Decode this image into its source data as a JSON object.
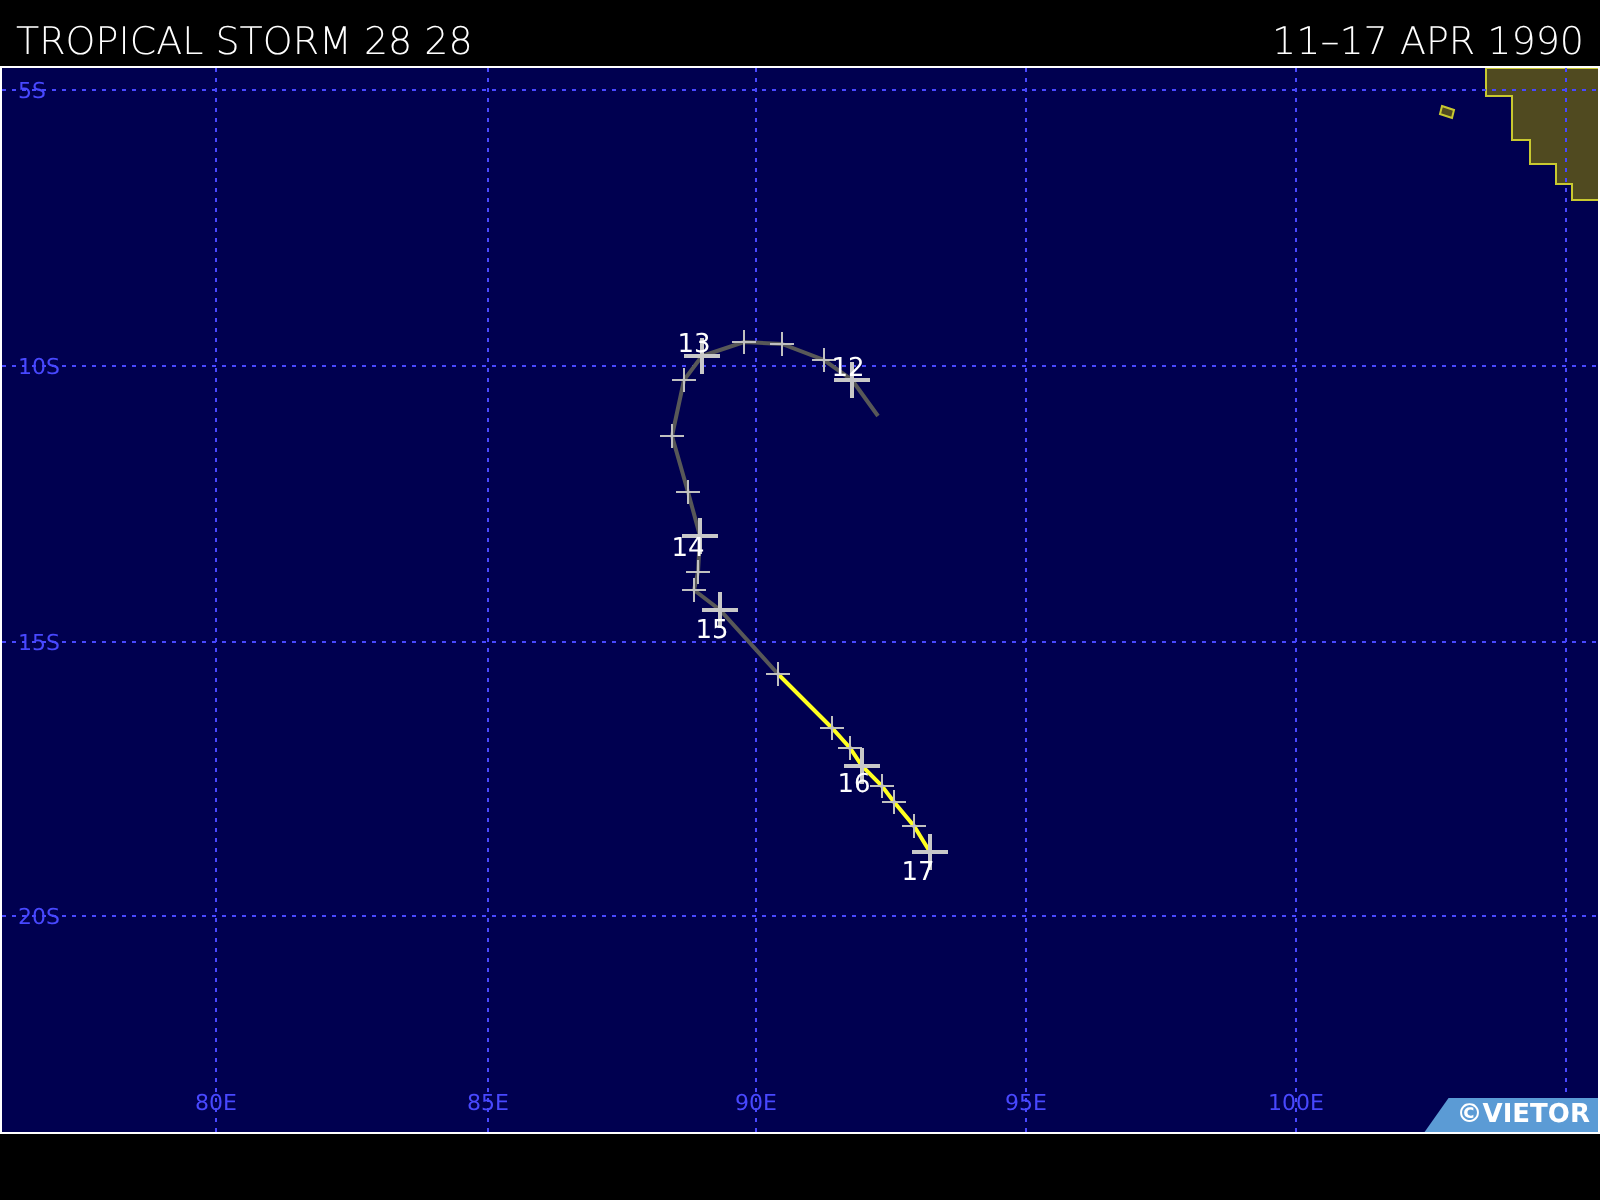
{
  "header": {
    "title": "TROPICAL STORM 28 28",
    "dates": "11–17 APR 1990"
  },
  "map": {
    "lat_labels": [
      "5S",
      "10S",
      "15S",
      "20S"
    ],
    "lon_labels": [
      "80E",
      "85E",
      "90E",
      "95E",
      "100E"
    ],
    "day_labels": [
      "12",
      "13",
      "14",
      "15",
      "16",
      "17"
    ],
    "credit": "©VIETOR"
  }
}
